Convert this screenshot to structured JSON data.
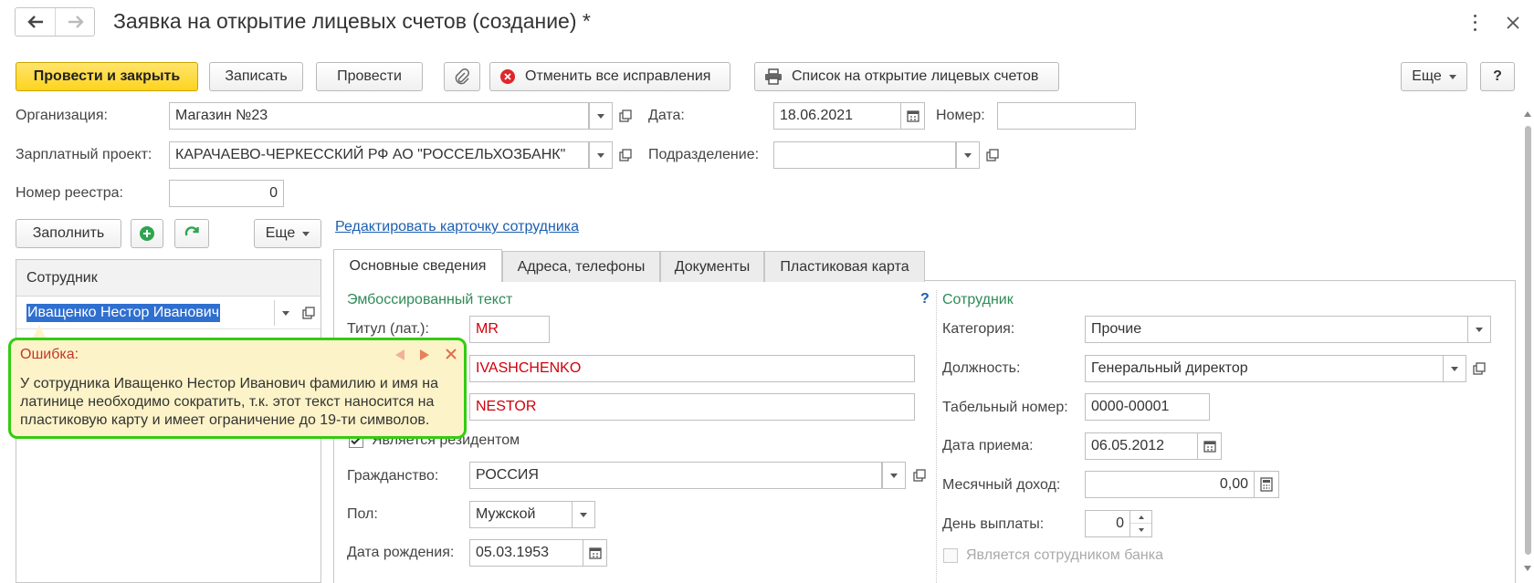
{
  "window": {
    "title": "Заявка на открытие лицевых счетов (создание) *"
  },
  "toolbar": {
    "post_close": "Провести и закрыть",
    "write": "Записать",
    "post": "Провести",
    "cancel_corrections": "Отменить все исправления",
    "print_list": "Список на открытие лицевых счетов",
    "more": "Еще",
    "help": "?"
  },
  "header": {
    "org_label": "Организация:",
    "org_value": "Магазин №23",
    "date_label": "Дата:",
    "date_value": "18.06.2021",
    "number_label": "Номер:",
    "number_value": "",
    "salary_project_label": "Зарплатный проект:",
    "salary_project_value": "КАРАЧАЕВО-ЧЕРКЕССКИЙ РФ АО \"РОССЕЛЬХОЗБАНК\"",
    "division_label": "Подразделение:",
    "division_value": "",
    "registry_label": "Номер реестра:",
    "registry_value": "0"
  },
  "left_panel": {
    "fill_button": "Заполнить",
    "more": "Еще",
    "column_header": "Сотрудник",
    "employee_value": "Иващенко Нестор Иванович"
  },
  "error_popup": {
    "title": "Ошибка:",
    "message": "У сотрудника Иващенко Нестор Иванович фамилию и имя на латинице необходимо сократить, т.к. этот текст наносится на пластиковую карту и имеет ограничение до 19-ти символов."
  },
  "edit_link": "Редактировать карточку сотрудника",
  "tabs": [
    "Основные сведения",
    "Адреса, телефоны",
    "Документы",
    "Пластиковая карта"
  ],
  "embossed": {
    "section_title": "Эмбоссированный текст",
    "help": "?",
    "title_label": "Титул (лат.):",
    "title_value": "MR",
    "surname_value": "IVASHCHENKO",
    "name_value": "NESTOR",
    "resident_label": "Является резидентом",
    "citizenship_label": "Гражданство:",
    "citizenship_value": "РОССИЯ",
    "gender_label": "Пол:",
    "gender_value": "Мужской",
    "birth_label": "Дата рождения:",
    "birth_value": "05.03.1953"
  },
  "employee": {
    "section_title": "Сотрудник",
    "category_label": "Категория:",
    "category_value": "Прочие",
    "position_label": "Должность:",
    "position_value": "Генеральный директор",
    "tab_num_label": "Табельный номер:",
    "tab_num_value": "0000-00001",
    "hire_label": "Дата приема:",
    "hire_value": "06.05.2012",
    "income_label": "Месячный доход:",
    "income_value": "0,00",
    "payday_label": "День выплаты:",
    "payday_value": "0",
    "bank_employee_label": "Является сотрудником банка"
  },
  "colors": {
    "primary_button": "#fdd41f",
    "error_border": "#33cc11",
    "error_bg": "#fdf3c8",
    "error_title": "#c0392b",
    "link": "#1c5fb0",
    "section_title": "#2e8b57",
    "red_value": "#d0000a"
  }
}
